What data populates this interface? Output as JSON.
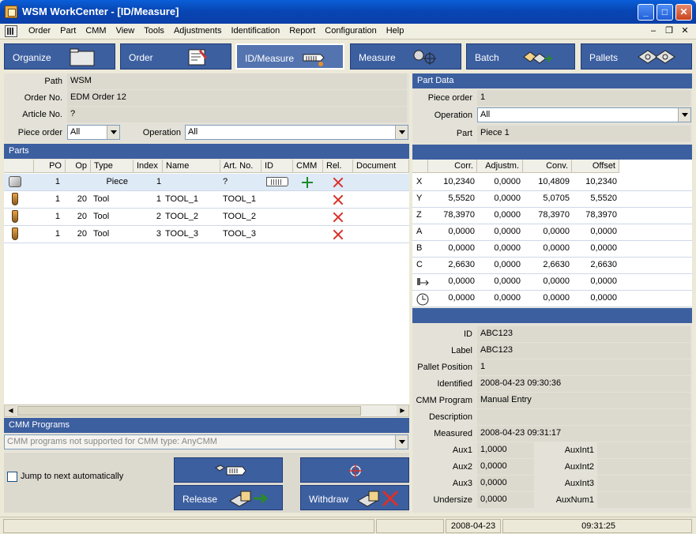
{
  "window": {
    "title": "WSM WorkCenter - [ID/Measure]"
  },
  "menu": [
    "Order",
    "Part",
    "CMM",
    "View",
    "Tools",
    "Adjustments",
    "Identification",
    "Report",
    "Configuration",
    "Help"
  ],
  "toolbar": {
    "buttons": [
      {
        "label": "Organize"
      },
      {
        "label": "Order"
      },
      {
        "label": "ID/Measure"
      },
      {
        "label": "Measure"
      },
      {
        "label": "Batch"
      },
      {
        "label": "Pallets"
      }
    ]
  },
  "order_info": {
    "path_label": "Path",
    "path": "WSM",
    "order_no_label": "Order No.",
    "order_no": "EDM Order 12",
    "article_no_label": "Article No.",
    "article_no": "?",
    "piece_order_label": "Piece order",
    "piece_order": "All",
    "operation_label": "Operation",
    "operation": "All"
  },
  "parts": {
    "title": "Parts",
    "columns": [
      "PO",
      "Op",
      "Type",
      "Index",
      "Name",
      "Art. No.",
      "ID",
      "CMM",
      "Rel.",
      "Document"
    ],
    "rows": [
      {
        "po": "1",
        "op": "",
        "type": "Piece",
        "index": "1",
        "name": "",
        "art_no": "?",
        "icon": "piece-icon"
      },
      {
        "po": "1",
        "op": "20",
        "type": "Tool",
        "index": "1",
        "name": "TOOL_1",
        "art_no": "TOOL_1",
        "icon": "tool-icon"
      },
      {
        "po": "1",
        "op": "20",
        "type": "Tool",
        "index": "2",
        "name": "TOOL_2",
        "art_no": "TOOL_2",
        "icon": "tool-icon"
      },
      {
        "po": "1",
        "op": "20",
        "type": "Tool",
        "index": "3",
        "name": "TOOL_3",
        "art_no": "TOOL_3",
        "icon": "tool-icon"
      }
    ]
  },
  "cmm_programs": {
    "title": "CMM Programs",
    "value": "CMM programs not supported for CMM type: AnyCMM"
  },
  "bottom": {
    "jump_label": "Jump to next automatically",
    "release_label": "Release",
    "withdraw_label": "Withdraw"
  },
  "part_data": {
    "title": "Part Data",
    "piece_order_label": "Piece order",
    "piece_order": "1",
    "operation_label": "Operation",
    "operation": "All",
    "part_label": "Part",
    "part": "Piece 1"
  },
  "offsets": {
    "columns": [
      "Corr.",
      "Adjustm.",
      "Conv.",
      "Offset"
    ],
    "rows": [
      {
        "axis": "X",
        "vals": [
          "10,2340",
          "0,0000",
          "10,4809",
          "10,2340"
        ]
      },
      {
        "axis": "Y",
        "vals": [
          "5,5520",
          "0,0000",
          "5,0705",
          "5,5520"
        ]
      },
      {
        "axis": "Z",
        "vals": [
          "78,3970",
          "0,0000",
          "78,3970",
          "78,3970"
        ]
      },
      {
        "axis": "A",
        "vals": [
          "0,0000",
          "0,0000",
          "0,0000",
          "0,0000"
        ]
      },
      {
        "axis": "B",
        "vals": [
          "0,0000",
          "0,0000",
          "0,0000",
          "0,0000"
        ]
      },
      {
        "axis": "C",
        "vals": [
          "2,6630",
          "0,0000",
          "2,6630",
          "2,6630"
        ]
      },
      {
        "axis": "",
        "vals": [
          "0,0000",
          "0,0000",
          "0,0000",
          "0,0000"
        ]
      },
      {
        "axis": "",
        "vals": [
          "0,0000",
          "0,0000",
          "0,0000",
          "0,0000"
        ]
      }
    ]
  },
  "details": {
    "id_label": "ID",
    "id": "ABC123",
    "label_label": "Label",
    "label": "ABC123",
    "pallet_label": "Pallet Position",
    "pallet": "1",
    "identified_label": "Identified",
    "identified": "2008-04-23 09:30:36",
    "cmm_program_label": "CMM Program",
    "cmm_program": "Manual Entry",
    "description_label": "Description",
    "description": "",
    "measured_label": "Measured",
    "measured": "2008-04-23 09:31:17",
    "aux1_label": "Aux1",
    "aux1": "1,0000",
    "aux2_label": "Aux2",
    "aux2": "0,0000",
    "aux3_label": "Aux3",
    "aux3": "0,0000",
    "undersize_label": "Undersize",
    "undersize": "0,0000",
    "auxint1_label": "AuxInt1",
    "auxint1": "",
    "auxint2_label": "AuxInt2",
    "auxint2": "",
    "auxint3_label": "AuxInt3",
    "auxint3": "",
    "auxnum1_label": "AuxNum1",
    "auxnum1": ""
  },
  "status": {
    "date": "2008-04-23",
    "time": "09:31:25"
  }
}
